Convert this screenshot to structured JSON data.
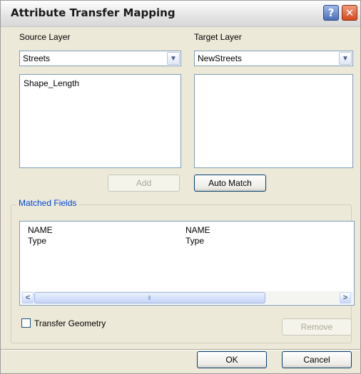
{
  "dialog": {
    "title": "Attribute Transfer Mapping",
    "help_label": "?",
    "close_label": "✕"
  },
  "source": {
    "label": "Source Layer",
    "selected_layer": "Streets",
    "fields": [
      "Shape_Length"
    ]
  },
  "target": {
    "label": "Target Layer",
    "selected_layer": "NewStreets",
    "fields": []
  },
  "buttons": {
    "add": "Add",
    "auto_match": "Auto Match",
    "remove": "Remove",
    "ok": "OK",
    "cancel": "Cancel"
  },
  "matched": {
    "title": "Matched Fields",
    "rows": [
      {
        "source": "NAME",
        "target": "NAME"
      },
      {
        "source": "Type",
        "target": "Type"
      }
    ],
    "scroll_left": "<",
    "scroll_right": ">",
    "scroll_grip": "III"
  },
  "options": {
    "transfer_geometry_label": "Transfer Geometry",
    "transfer_geometry_checked": false
  },
  "icons": {
    "dropdown": "chevron-down-icon",
    "help": "help-icon",
    "close": "close-icon"
  },
  "colors": {
    "dialog_bg": "#ece9d8",
    "group_title": "#0046d5",
    "close_button": "#d24a1f",
    "field_border": "#7f9db9"
  }
}
